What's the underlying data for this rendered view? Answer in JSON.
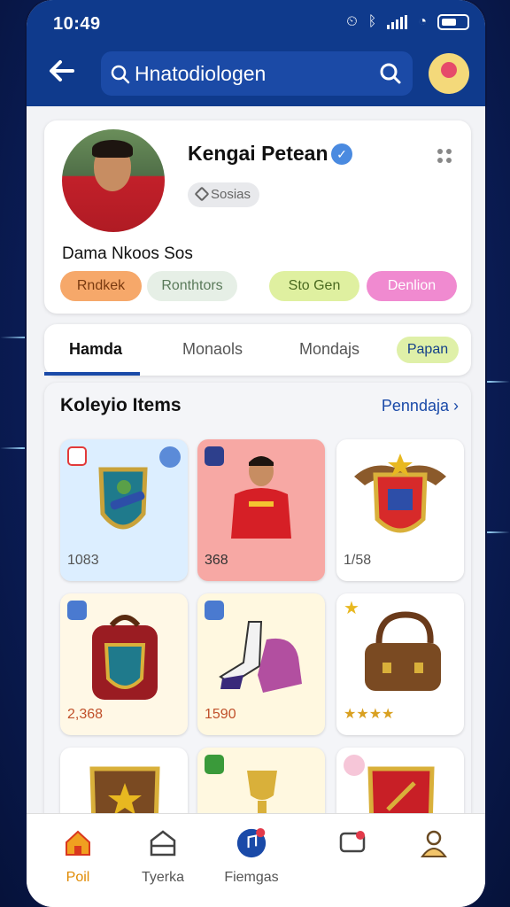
{
  "status_bar": {
    "time": "10:49"
  },
  "search": {
    "text": "Hnatodiologen"
  },
  "profile": {
    "name": "Kengai Petean",
    "badge": "Sosias",
    "subname": "Dama Nkoos Sos",
    "chips": [
      {
        "label": "Rndkek",
        "color": "#f6a86a",
        "text_color": "#7a3a10"
      },
      {
        "label": "Ronthtors",
        "color": "#e6efe6",
        "text_color": "#5a7a5a"
      },
      {
        "label": "Sto Gen",
        "color": "#dff0a0",
        "text_color": "#4a6a20"
      },
      {
        "label": "Denlion",
        "color": "#f08ad0",
        "text_color": "#ffffff"
      }
    ]
  },
  "tabs": [
    {
      "label": "Hamda",
      "active": true
    },
    {
      "label": "Monaols",
      "active": false
    },
    {
      "label": "Mondajs",
      "active": false
    },
    {
      "label": "Papan",
      "active": false
    }
  ],
  "collection": {
    "title": "Koleyio Items",
    "link": "Penndaja",
    "items": [
      {
        "name": "shield-trophy",
        "value": "1083",
        "bg": "#dceeff"
      },
      {
        "name": "player-card",
        "value": "368",
        "bg": "#f7a8a4"
      },
      {
        "name": "crest-badge",
        "value": "1/58",
        "bg": "#ffffff"
      },
      {
        "name": "backpack",
        "value": "2,368",
        "bg": "#fff8e6"
      },
      {
        "name": "boots",
        "value": "1590",
        "bg": "#fff8e0"
      },
      {
        "name": "bag",
        "value": "★★★★",
        "bg": "#ffffff"
      },
      {
        "name": "shield-star",
        "value": "",
        "bg": "#ffffff"
      },
      {
        "name": "trophy",
        "value": "",
        "bg": "#fff8e0"
      },
      {
        "name": "crest-red",
        "value": "",
        "bg": "#ffffff"
      }
    ]
  },
  "bottom_nav": [
    {
      "label": "Poil",
      "active": true
    },
    {
      "label": "Tyerka",
      "active": false
    },
    {
      "label": "Fiemgas",
      "active": false
    },
    {
      "label": "",
      "active": false
    },
    {
      "label": "",
      "active": false
    }
  ]
}
